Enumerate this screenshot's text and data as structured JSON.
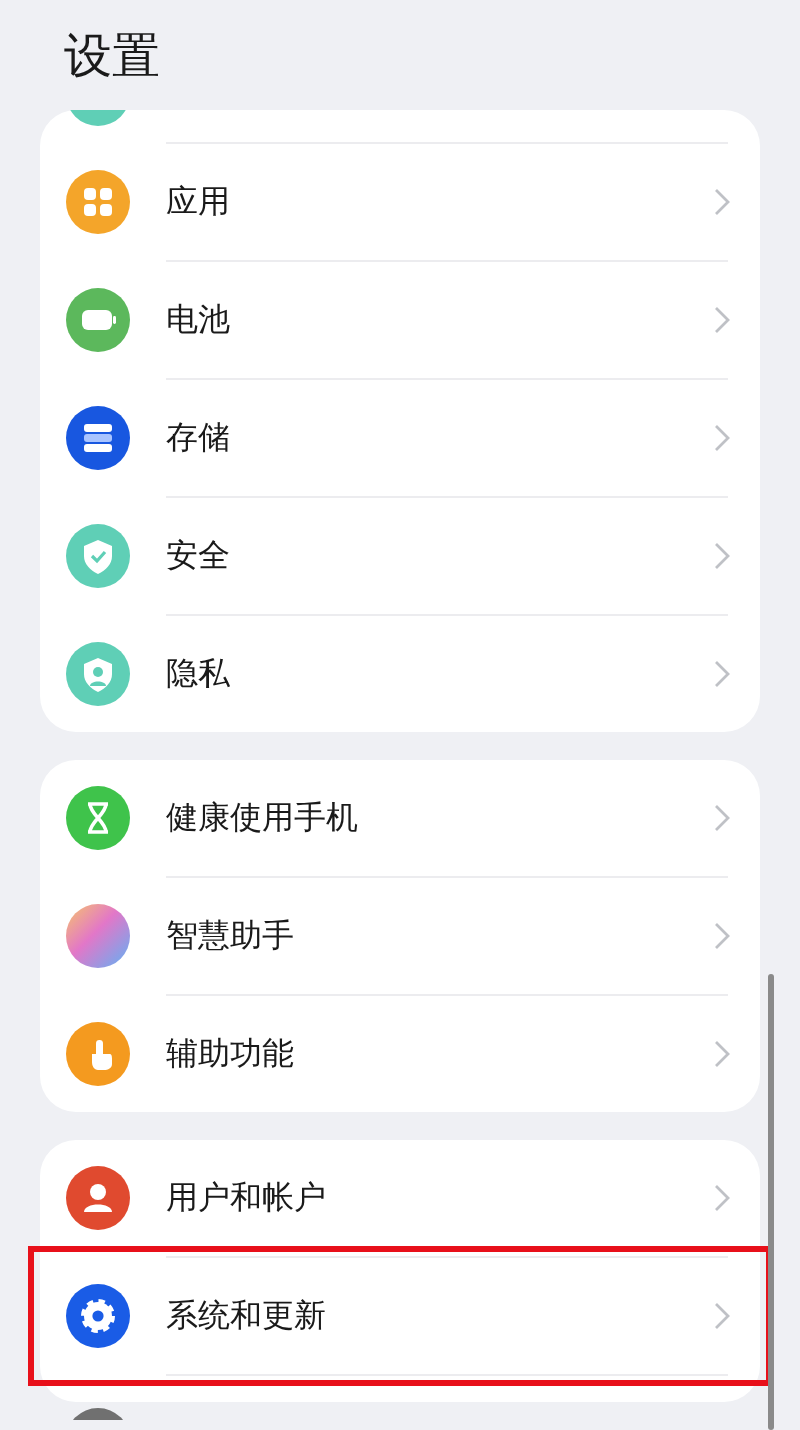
{
  "title": "设置",
  "groups": [
    {
      "items": [
        {
          "label": "应用",
          "kind": "apps",
          "highlighted": false
        },
        {
          "label": "电池",
          "kind": "battery",
          "highlighted": false
        },
        {
          "label": "存储",
          "kind": "storage",
          "highlighted": false
        },
        {
          "label": "安全",
          "kind": "security",
          "highlighted": false
        },
        {
          "label": "隐私",
          "kind": "privacy",
          "highlighted": false
        }
      ]
    },
    {
      "items": [
        {
          "label": "健康使用手机",
          "kind": "hourglass",
          "highlighted": false
        },
        {
          "label": "智慧助手",
          "kind": "orb",
          "highlighted": false
        },
        {
          "label": "辅助功能",
          "kind": "touch",
          "highlighted": false
        }
      ]
    },
    {
      "items": [
        {
          "label": "用户和帐户",
          "kind": "user",
          "highlighted": false
        },
        {
          "label": "系统和更新",
          "kind": "gear",
          "highlighted": true
        }
      ]
    }
  ]
}
